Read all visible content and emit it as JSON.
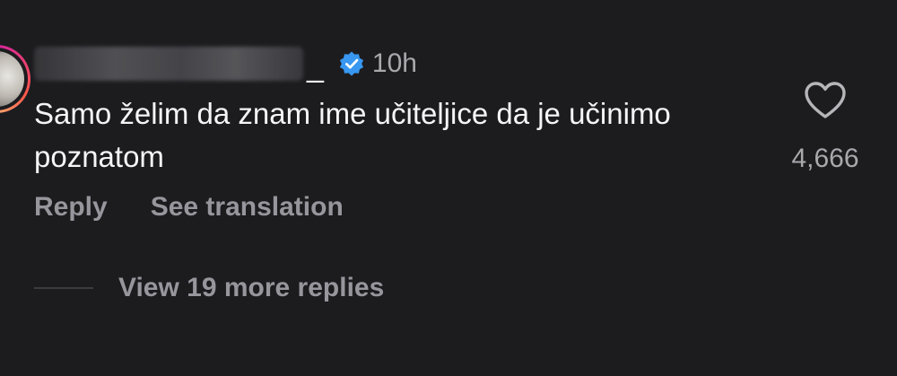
{
  "comment": {
    "username_suffix": "_",
    "timestamp": "10h",
    "text": "Samo želim da znam ime učiteljice da je učinimo poznatom",
    "like_count": "4,666",
    "verified": true
  },
  "actions": {
    "reply_label": "Reply",
    "translate_label": "See translation"
  },
  "replies": {
    "label": "View 19 more replies"
  },
  "icons": {
    "verified": "verified-badge-icon",
    "like": "heart-outline-icon"
  },
  "colors": {
    "background": "#1c1c1f",
    "verified_blue": "#3897f0",
    "primary_text": "#f5f5f7",
    "secondary_text": "#96969c"
  }
}
